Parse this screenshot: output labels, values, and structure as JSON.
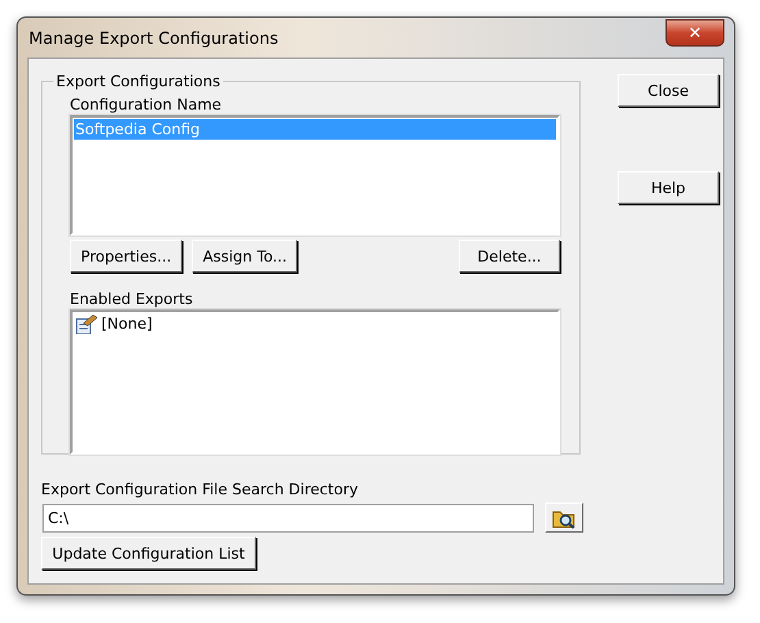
{
  "window": {
    "title": "Manage Export Configurations",
    "close_glyph": "✕"
  },
  "group": {
    "title": "Export Configurations",
    "config_list": {
      "label": "Configuration Name",
      "items": [
        {
          "label": "Softpedia Config",
          "selected": true
        }
      ]
    },
    "buttons": [
      "Properties...",
      "Assign To...",
      "Delete..."
    ],
    "exports_list": {
      "label": "Enabled Exports",
      "items": [
        {
          "label": "[None]",
          "selected": false
        }
      ]
    }
  },
  "side_buttons": [
    "Close",
    "Help"
  ],
  "directory": {
    "label": "Export Configuration File Search Directory",
    "value": "C:\\"
  },
  "update_button": "Update Configuration List"
}
